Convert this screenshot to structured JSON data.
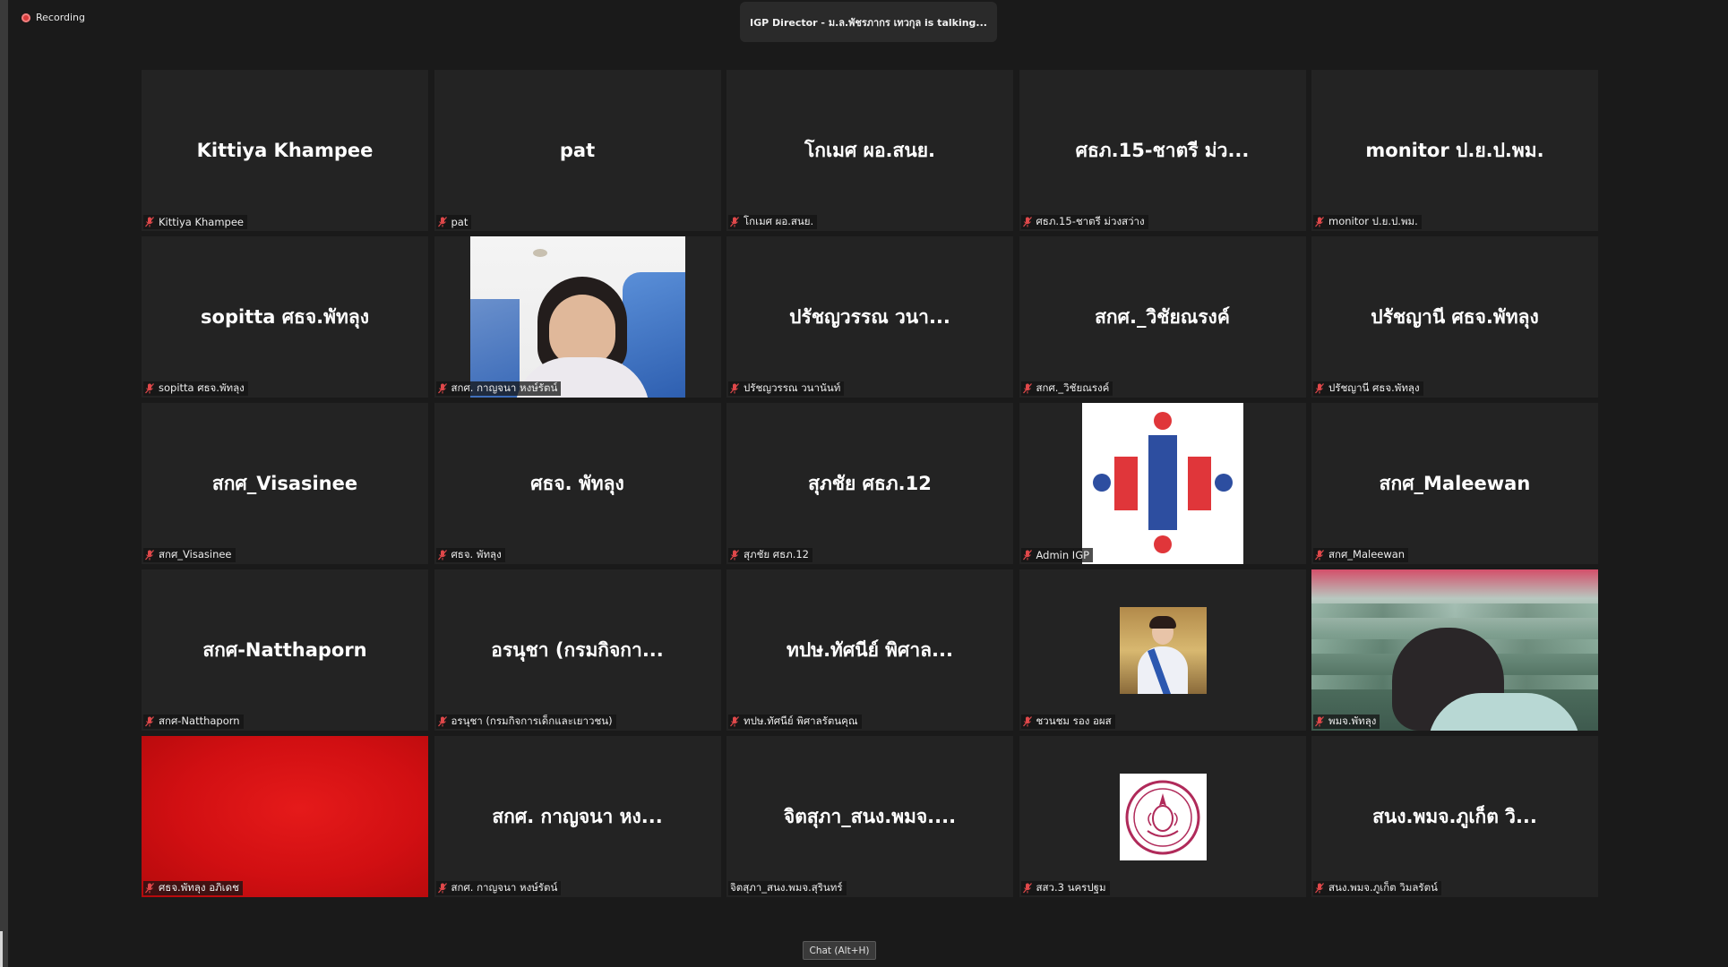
{
  "recording": {
    "label": "Recording"
  },
  "talking": {
    "text": "IGP Director - ม.ล.พัชรภากร เทวกุล is  talking..."
  },
  "tiles": [
    {
      "big": "Kittiya Khampee",
      "label": "Kittiya Khampee"
    },
    {
      "big": "pat",
      "label": "pat"
    },
    {
      "big": "โกเมศ ผอ.สนย.",
      "label": "โกเมศ ผอ.สนย."
    },
    {
      "big": "ศธภ.15-ชาตรี ม่ว...",
      "label": "ศธภ.15-ชาตรี ม่วงสว่าง"
    },
    {
      "big": "monitor ป.ย.ป.พม.",
      "label": "monitor ป.ย.ป.พม."
    },
    {
      "big": "sopitta ศธจ.พัทลุง",
      "label": "sopitta ศธจ.พัทลุง"
    },
    {
      "big": "",
      "label": "สกศ. กาญจนา หงษ์รัตน์"
    },
    {
      "big": "ปรัชญวรรณ วนา...",
      "label": "ปรัชญวรรณ วนานันท์"
    },
    {
      "big": "สกศ._วิชัยณรงค์",
      "label": "สกศ._วิชัยณรงค์"
    },
    {
      "big": "ปรัชญานี ศธจ.พัทลุง",
      "label": "ปรัชญานี ศธจ.พัทลุง"
    },
    {
      "big": "สกศ_Visasinee",
      "label": "สกศ_Visasinee"
    },
    {
      "big": "ศธจ. พัทลุง",
      "label": "ศธจ. พัทลุง"
    },
    {
      "big": "สุภชัย ศธภ.12",
      "label": "สุภชัย ศธภ.12"
    },
    {
      "big": "",
      "label": "Admin IGP"
    },
    {
      "big": "สกศ_Maleewan",
      "label": "สกศ_Maleewan"
    },
    {
      "big": "สกศ-Natthaporn",
      "label": "สกศ-Natthaporn"
    },
    {
      "big": "อรนุชา (กรมกิจกา...",
      "label": "อรนุชา (กรมกิจการเด็กและเยาวชน)"
    },
    {
      "big": "ทปษ.ทัศนีย์ พิศาล...",
      "label": "ทปษ.ทัศนีย์ พิศาลรัตนคุณ"
    },
    {
      "big": "",
      "label": "ชวนชม รอง อผส"
    },
    {
      "big": "",
      "label": "พมจ.พัทลุง"
    },
    {
      "big": "",
      "label": "ศธจ.พัทลุง อภิเดช"
    },
    {
      "big": "สกศ. กาญจนา หง...",
      "label": "สกศ. กาญจนา หงษ์รัตน์"
    },
    {
      "big": "จิตสุภา_สนง.พมจ....",
      "label": "จิตสุภา_สนง.พมจ.สุรินทร์"
    },
    {
      "big": "",
      "label": "สสว.3 นครปฐม"
    },
    {
      "big": "สนง.พมจ.ภูเก็ต วิ...",
      "label": "สนง.พมจ.ภูเก็ต วิมลรัตน์"
    }
  ],
  "chat": {
    "label": "Chat (Alt+H)"
  },
  "colors": {
    "background": "#1a1a1a",
    "tile": "#232323",
    "mic_muted": "#e0484a",
    "igp_blue": "#2d4ea0",
    "igp_red": "#e0363a"
  }
}
